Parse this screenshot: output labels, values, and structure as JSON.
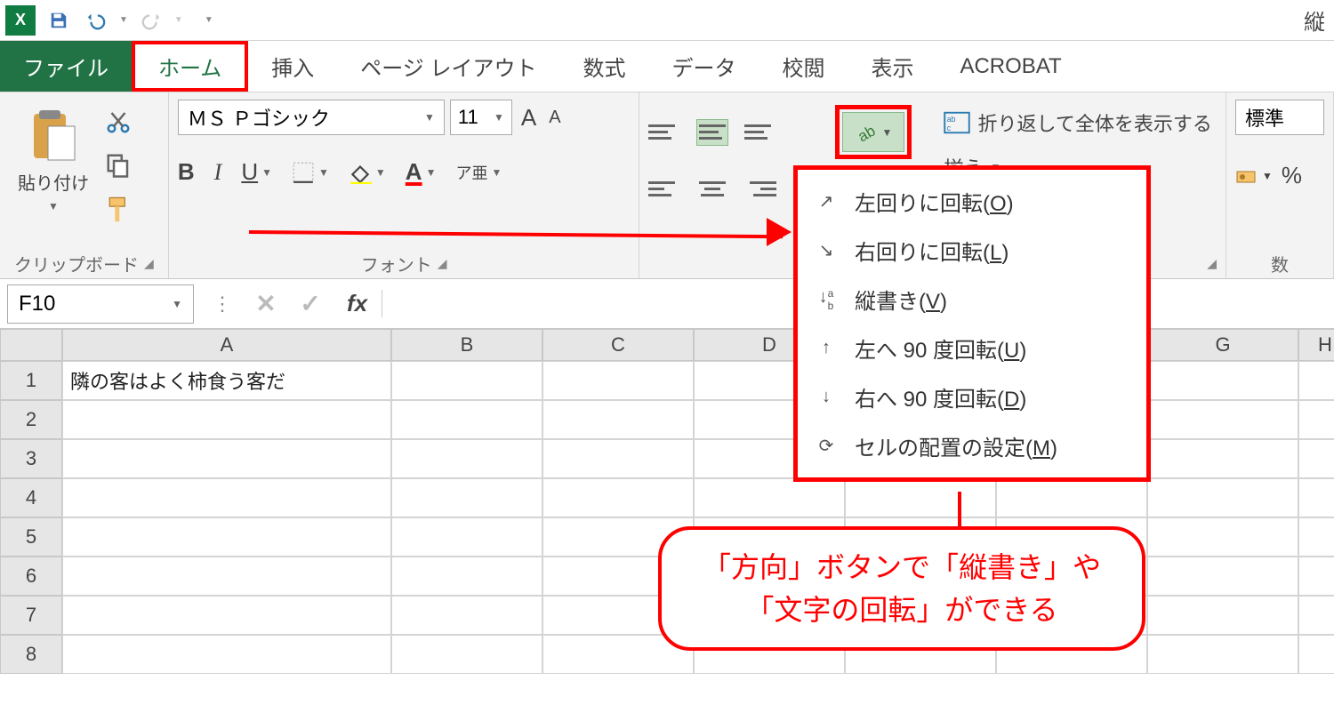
{
  "title_right": "縦",
  "tabs": {
    "file": "ファイル",
    "home": "ホーム",
    "insert": "挿入",
    "page_layout": "ページ レイアウト",
    "formulas": "数式",
    "data": "データ",
    "review": "校閲",
    "view": "表示",
    "acrobat": "ACROBAT"
  },
  "clipboard": {
    "paste": "貼り付け",
    "group": "クリップボード"
  },
  "font": {
    "name": "ＭＳ Ｐゴシック",
    "size": "11",
    "group": "フォント",
    "bold": "B",
    "italic": "I",
    "underline": "U",
    "ruby": "ア亜",
    "A_big": "A",
    "A_small": "A"
  },
  "alignment": {
    "wrap": "折り返して全体を表示する",
    "merge": "揃え"
  },
  "number": {
    "format": "標準",
    "percent": "%",
    "group": "数"
  },
  "orient_menu": [
    {
      "label_pre": "左回りに回転(",
      "key": "O",
      "label_post": ")"
    },
    {
      "label_pre": "右回りに回転(",
      "key": "L",
      "label_post": ")"
    },
    {
      "label_pre": "縦書き(",
      "key": "V",
      "label_post": ")"
    },
    {
      "label_pre": "左へ 90 度回転(",
      "key": "U",
      "label_post": ")"
    },
    {
      "label_pre": "右へ 90 度回転(",
      "key": "D",
      "label_post": ")"
    },
    {
      "label_pre": "セルの配置の設定(",
      "key": "M",
      "label_post": ")"
    }
  ],
  "namebox": "F10",
  "fx": "fx",
  "columns": [
    "A",
    "B",
    "C",
    "D",
    "",
    "",
    "G",
    "H"
  ],
  "rows": [
    "1",
    "2",
    "3",
    "4",
    "5",
    "6",
    "7",
    "8"
  ],
  "cell_A1": "隣の客はよく柿食う客だ",
  "callout_l1": "「方向」ボタンで「縦書き」や",
  "callout_l2": "「文字の回転」ができる"
}
